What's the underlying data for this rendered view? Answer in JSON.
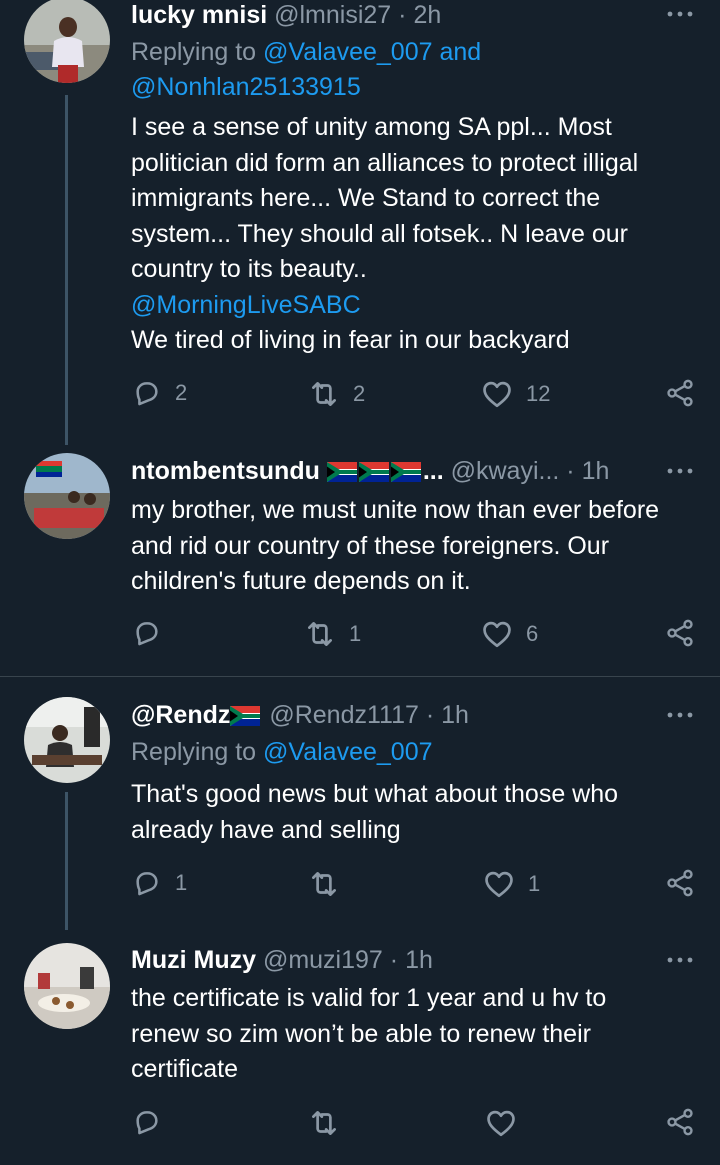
{
  "tweets": [
    {
      "name": "lucky mnisi",
      "handle": "@lmnisi27",
      "separator": "·",
      "time": "2h",
      "replying_prefix": "Replying to",
      "replying_mention1": "@Valavee_007",
      "replying_and": "and",
      "replying_mention2": "@Nonhlan25133915",
      "lines": [
        "I see a sense of unity among SA ppl... Most",
        "politician did form an alliances to protect illigal",
        "immigrants here... We Stand to correct the",
        "system... They should all fotsek.. N leave our",
        "country to its beauty..",
        "@MorningLiveSABC",
        "We tired of living in fear in our backyard"
      ],
      "replies": "2",
      "retweets": "2",
      "likes": "12"
    },
    {
      "name": "ntombentsundu",
      "name_suffix": "...",
      "handle": "@kwayi...",
      "separator": "·",
      "time": "1h",
      "lines": [
        "my brother, we must unite now than ever before",
        "and rid our country of these foreigners. Our",
        "children's future depends on it."
      ],
      "retweets": "1",
      "likes": "6"
    },
    {
      "name": "@Rendz",
      "handle": "@Rendz1117",
      "separator": "·",
      "time": "1h",
      "replying_prefix": "Replying to",
      "replying_mention1": "@Valavee_007",
      "lines": [
        "That's good news but what about those who",
        "already have and selling"
      ],
      "replies": "1",
      "likes": "1"
    },
    {
      "name": "Muzi Muzy",
      "handle": "@muzi197",
      "separator": "·",
      "time": "1h",
      "lines": [
        "the certificate is valid for 1 year and u hv to",
        "renew so zim won’t be able to renew their",
        "certificate"
      ]
    }
  ],
  "icons": {
    "reply": "reply-icon",
    "retweet": "retweet-icon",
    "like": "heart-icon",
    "share": "share-icon",
    "more": "more-options-icon",
    "flag": "south-africa-flag-icon"
  },
  "colors": {
    "background": "#15202b",
    "primary_text": "#ffffff",
    "secondary_text": "#8b98a5",
    "link": "#1d9bf0",
    "divider": "#38444d"
  }
}
